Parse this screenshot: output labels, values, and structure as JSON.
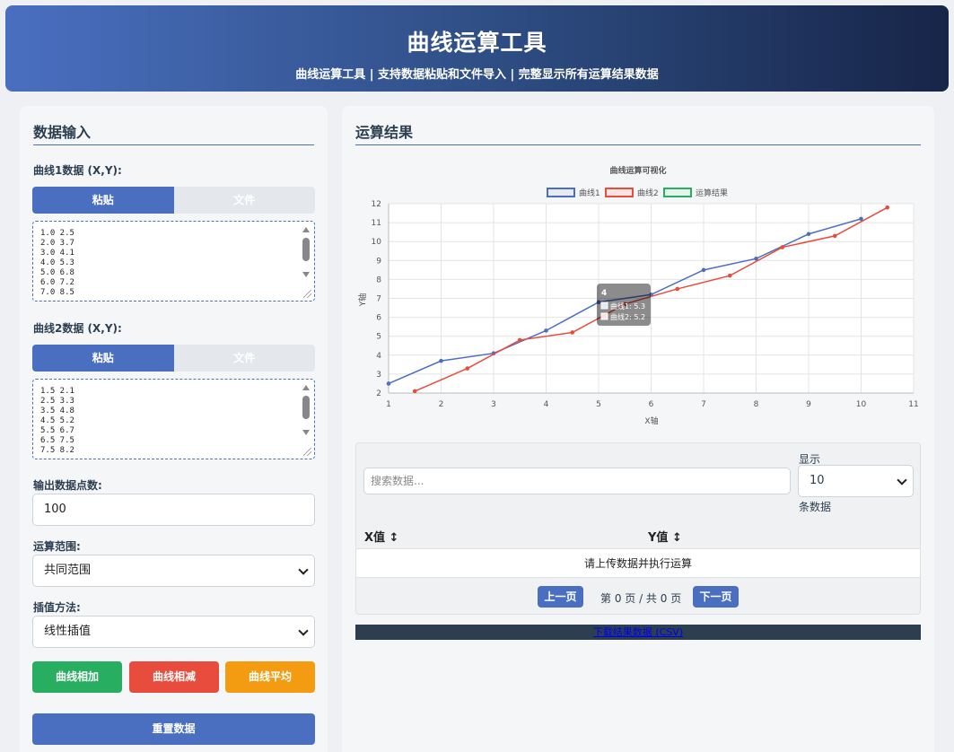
{
  "header": {
    "title": "曲线运算工具",
    "subtitle": "曲线运算工具 | 支持数据粘贴和文件导入 | 完整显示所有运算结果数据"
  },
  "input_panel": {
    "title": "数据输入",
    "curve1": {
      "label": "曲线1数据 (X,Y):",
      "tab_paste": "粘贴",
      "tab_file": "文件",
      "lines": [
        "1.0 2.5",
        "2.0 3.7",
        "3.0 4.1",
        "4.0 5.3",
        "5.0 6.8",
        "6.0 7.2",
        "7.0 8.5"
      ]
    },
    "curve2": {
      "label": "曲线2数据 (X,Y):",
      "tab_paste": "粘贴",
      "tab_file": "文件",
      "lines": [
        "1.5 2.1",
        "2.5 3.3",
        "3.5 4.8",
        "4.5 5.2",
        "5.5 6.7",
        "6.5 7.5",
        "7.5 8.2"
      ]
    },
    "points": {
      "label": "输出数据点数:",
      "value": "100"
    },
    "range": {
      "label": "运算范围:",
      "value": "共同范围"
    },
    "method": {
      "label": "插值方法:",
      "value": "线性插值"
    },
    "buttons": {
      "add": "曲线相加",
      "subtract": "曲线相减",
      "average": "曲线平均",
      "reset": "重置数据"
    }
  },
  "result_panel": {
    "title": "运算结果",
    "table": {
      "search_placeholder": "搜索数据...",
      "show_label": "显示",
      "show_value": "10",
      "show_suffix": "条数据",
      "col_x": "X值 ↕",
      "col_y": "Y值 ↕",
      "empty_message": "请上传数据并执行运算",
      "prev": "上一页",
      "page_info": "第 0 页 / 共 0 页",
      "next": "下一页"
    },
    "download": "下载结果数据 (CSV)"
  },
  "chart_data": {
    "type": "line",
    "title": "曲线运算可视化",
    "xlabel": "X轴",
    "ylabel": "Y轴",
    "xlim": [
      1,
      11
    ],
    "ylim": [
      2,
      12
    ],
    "xticks": [
      1,
      2,
      3,
      4,
      5,
      6,
      7,
      8,
      9,
      10,
      11
    ],
    "yticks": [
      2,
      3,
      4,
      5,
      6,
      7,
      8,
      9,
      10,
      11,
      12
    ],
    "grid": true,
    "legend_position": "top",
    "series": [
      {
        "name": "曲线1",
        "color": "#4a6fc0",
        "points": [
          [
            1,
            2.5
          ],
          [
            2,
            3.7
          ],
          [
            3,
            4.1
          ],
          [
            4,
            5.3
          ],
          [
            5,
            6.8
          ],
          [
            6,
            7.2
          ],
          [
            7,
            8.5
          ],
          [
            8,
            9.1
          ],
          [
            9,
            10.4
          ],
          [
            10,
            11.2
          ]
        ]
      },
      {
        "name": "曲线2",
        "color": "#e74c3c",
        "points": [
          [
            1.5,
            2.1
          ],
          [
            2.5,
            3.3
          ],
          [
            3.5,
            4.8
          ],
          [
            4.5,
            5.2
          ],
          [
            5.5,
            6.7
          ],
          [
            6.5,
            7.5
          ],
          [
            7.5,
            8.2
          ],
          [
            8.5,
            9.7
          ],
          [
            9.5,
            10.3
          ],
          [
            10.5,
            11.8
          ]
        ]
      },
      {
        "name": "运算结果",
        "color": "#27ae60",
        "points": []
      }
    ],
    "tooltip": {
      "title": "4",
      "lines": [
        "曲线1: 5.3",
        "曲线2: 5.2"
      ]
    }
  }
}
